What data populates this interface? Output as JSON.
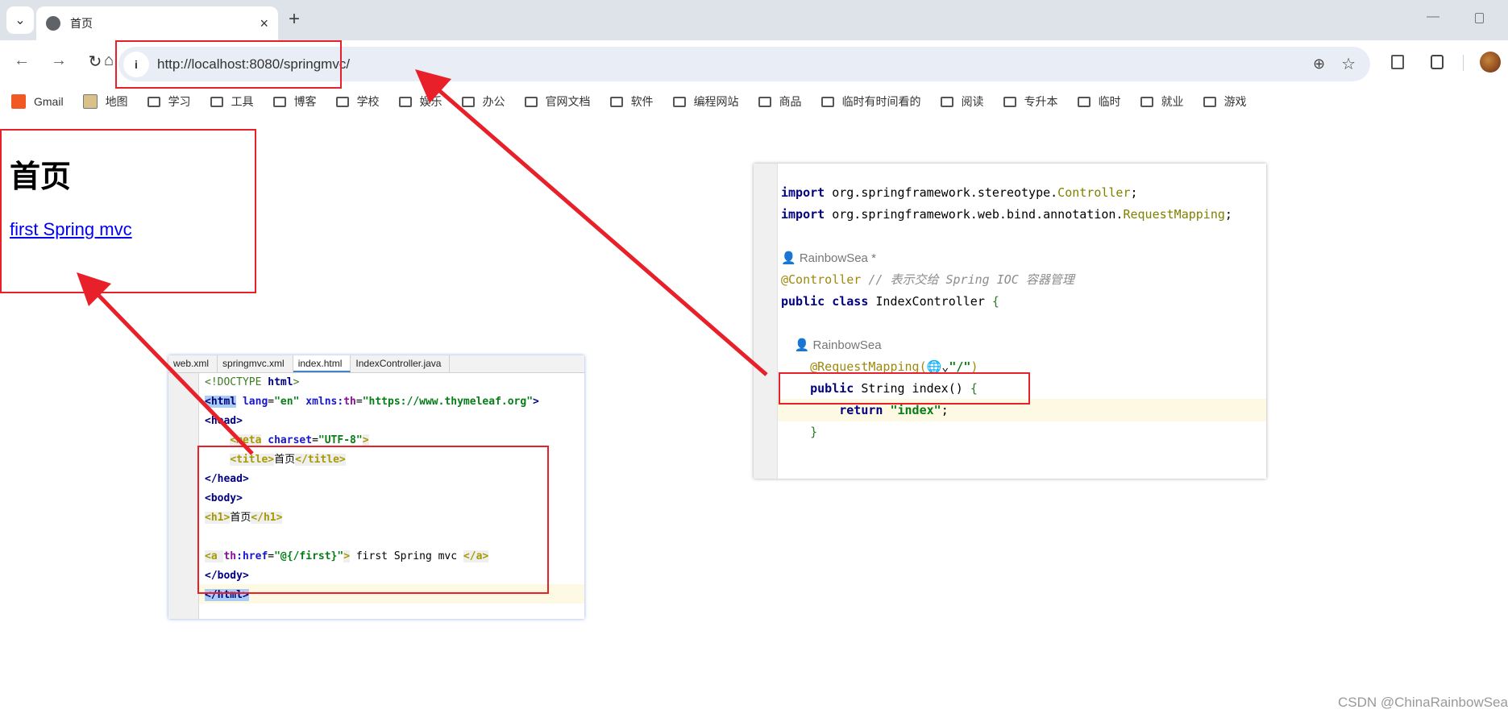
{
  "browser": {
    "tab_title": "首页",
    "tab_close": "×",
    "new_tab": "+",
    "tab_menu": "⌄",
    "minimize": "—",
    "url": "http://localhost:8080/springmvc/",
    "nav": {
      "back": "←",
      "forward": "→",
      "reload": "↻",
      "home": "⌂"
    },
    "bookmarks": [
      {
        "label": "Gmail",
        "icon": "gmail-icon"
      },
      {
        "label": "地图",
        "icon": "map-icon"
      },
      {
        "label": "学习",
        "icon": "folder-icon"
      },
      {
        "label": "工具",
        "icon": "folder-icon"
      },
      {
        "label": "博客",
        "icon": "folder-icon"
      },
      {
        "label": "学校",
        "icon": "folder-icon"
      },
      {
        "label": "娱乐",
        "icon": "folder-icon"
      },
      {
        "label": "办公",
        "icon": "folder-icon"
      },
      {
        "label": "官网文档",
        "icon": "folder-icon"
      },
      {
        "label": "软件",
        "icon": "folder-icon"
      },
      {
        "label": "编程网站",
        "icon": "folder-icon"
      },
      {
        "label": "商品",
        "icon": "folder-icon"
      },
      {
        "label": "临时有时间看的",
        "icon": "folder-icon"
      },
      {
        "label": "阅读",
        "icon": "folder-icon"
      },
      {
        "label": "专升本",
        "icon": "folder-icon"
      },
      {
        "label": "临时",
        "icon": "folder-icon"
      },
      {
        "label": "就业",
        "icon": "folder-icon"
      },
      {
        "label": "游戏",
        "icon": "folder-icon"
      }
    ]
  },
  "page": {
    "heading": "首页",
    "link": "first Spring mvc"
  },
  "ide_left": {
    "tabs": [
      "web.xml",
      "springmvc.xml",
      "index.html",
      "IndexController.java"
    ],
    "active_tab": 2,
    "lines": [
      [
        [
          "doctype",
          "<!DOCTYPE "
        ],
        [
          "kw",
          "html"
        ],
        [
          "doctype",
          ">"
        ]
      ],
      [
        [
          "tagh",
          "<html"
        ],
        [
          "attr",
          " lang"
        ],
        [
          "p",
          "="
        ],
        [
          "str",
          "\"en\""
        ],
        [
          "attr",
          " xmlns:"
        ],
        [
          "ns",
          "th"
        ],
        [
          "p",
          "="
        ],
        [
          "str",
          "\"https://www.thymeleaf.org\""
        ],
        [
          "kw",
          ">"
        ]
      ],
      [
        [
          "kw",
          "<head>"
        ]
      ],
      [
        [
          "p",
          "    "
        ],
        [
          "ttag",
          "<meta"
        ],
        [
          "attr",
          " charset"
        ],
        [
          "p",
          "="
        ],
        [
          "str",
          "\"UTF-8\""
        ],
        [
          "ttag",
          ">"
        ]
      ],
      [
        [
          "p",
          "    "
        ],
        [
          "ttag",
          "<title>"
        ],
        [
          "txt",
          "首页"
        ],
        [
          "ttag",
          "</title>"
        ]
      ],
      [
        [
          "kw",
          "</head>"
        ]
      ],
      [
        [
          "kw",
          "<body>"
        ]
      ],
      [
        [
          "ttag",
          "<h1>"
        ],
        [
          "txt",
          "首页"
        ],
        [
          "ttag",
          "</h1>"
        ]
      ],
      [],
      [
        [
          "ttag",
          "<a "
        ],
        [
          "ns",
          "th"
        ],
        [
          "attr",
          ":href"
        ],
        [
          "p",
          "="
        ],
        [
          "str",
          "\"@{/first}\""
        ],
        [
          "ttag",
          ">"
        ],
        [
          "txt",
          " first Spring mvc "
        ],
        [
          "ttag",
          "</a>"
        ]
      ],
      [
        [
          "kw",
          "</body>"
        ]
      ],
      [
        [
          "tagh",
          "</html>"
        ]
      ]
    ]
  },
  "ide_right": {
    "lines": [
      [
        [
          "kw",
          "import"
        ],
        [
          "p",
          " org.springframework.stereotype."
        ],
        [
          "olive",
          "Controller"
        ],
        [
          "p",
          ";"
        ]
      ],
      [
        [
          "kw",
          "import"
        ],
        [
          "p",
          " org.springframework.web.bind.annotation."
        ],
        [
          "olive",
          "RequestMapping"
        ],
        [
          "p",
          ";"
        ]
      ],
      [],
      [
        [
          "author",
          "👤 RainbowSea *"
        ]
      ],
      [
        [
          "ann",
          "@Controller"
        ],
        [
          "cmt",
          " // 表示交给 Spring IOC 容器管理"
        ]
      ],
      [
        [
          "kw",
          "public class"
        ],
        [
          "p",
          " IndexController "
        ],
        [
          "brace",
          "{"
        ]
      ],
      [],
      [
        [
          "author",
          "    👤 RainbowSea"
        ]
      ],
      [
        [
          "p",
          "    "
        ],
        [
          "ann",
          "@RequestMapping("
        ],
        [
          "p",
          "🌐⌄"
        ],
        [
          "str",
          "\"/\""
        ],
        [
          "ann",
          ")"
        ]
      ],
      [
        [
          "p",
          "    "
        ],
        [
          "kw",
          "public"
        ],
        [
          "p",
          " String index() "
        ],
        [
          "brace",
          "{"
        ]
      ],
      [
        [
          "p",
          "        "
        ],
        [
          "kw",
          "return"
        ],
        [
          "str",
          " \"index\""
        ],
        [
          "p",
          ";"
        ]
      ],
      [
        [
          "p",
          "    "
        ],
        [
          "brace",
          "}"
        ]
      ]
    ]
  },
  "watermark": "CSDN @ChinaRainbowSea",
  "colors": {
    "annotation_red": "#e8202a",
    "link": "#0000ee"
  }
}
